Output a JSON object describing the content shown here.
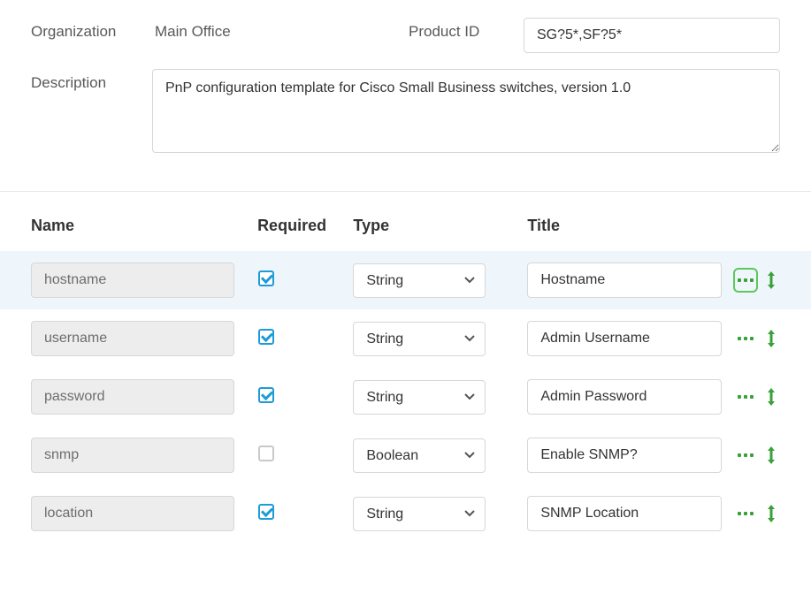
{
  "form": {
    "organization_label": "Organization",
    "organization_value": "Main Office",
    "product_id_label": "Product ID",
    "product_id_value": "SG?5*,SF?5*",
    "description_label": "Description",
    "description_value": "PnP configuration template for Cisco Small Business switches, version 1.0"
  },
  "table": {
    "headers": {
      "name": "Name",
      "required": "Required",
      "type": "Type",
      "title": "Title"
    },
    "type_options": [
      "String",
      "Boolean"
    ],
    "rows": [
      {
        "name": "hostname",
        "required": true,
        "type": "String",
        "title": "Hostname",
        "highlighted": true,
        "more_outlined": true
      },
      {
        "name": "username",
        "required": true,
        "type": "String",
        "title": "Admin Username",
        "highlighted": false,
        "more_outlined": false
      },
      {
        "name": "password",
        "required": true,
        "type": "String",
        "title": "Admin Password",
        "highlighted": false,
        "more_outlined": false
      },
      {
        "name": "snmp",
        "required": false,
        "type": "Boolean",
        "title": "Enable SNMP?",
        "highlighted": false,
        "more_outlined": false
      },
      {
        "name": "location",
        "required": true,
        "type": "String",
        "title": "SNMP Location",
        "highlighted": false,
        "more_outlined": false
      }
    ]
  }
}
